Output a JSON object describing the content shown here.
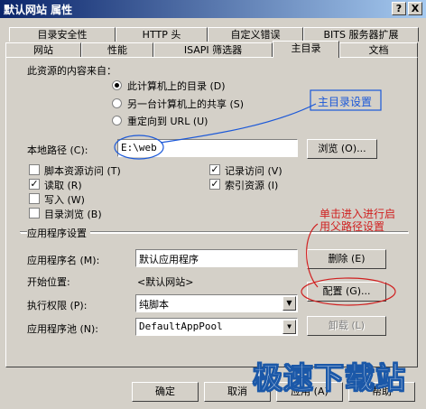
{
  "window": {
    "title": "默认网站 属性",
    "help_btn": "?",
    "close_btn": "X"
  },
  "tabs_row1": [
    {
      "label": "目录安全性"
    },
    {
      "label": "HTTP 头"
    },
    {
      "label": "自定义错误"
    },
    {
      "label": "BITS 服务器扩展"
    }
  ],
  "tabs_row2": [
    {
      "label": "网站"
    },
    {
      "label": "性能"
    },
    {
      "label": "ISAPI 筛选器"
    },
    {
      "label": "主目录",
      "active": true
    },
    {
      "label": "文档"
    }
  ],
  "source": {
    "heading": "此资源的内容来自：",
    "options": [
      {
        "label": "此计算机上的目录 (D)",
        "selected": true
      },
      {
        "label": "另一台计算机上的共享 (S)",
        "selected": false
      },
      {
        "label": "重定向到 URL (U)",
        "selected": false
      }
    ]
  },
  "local_path": {
    "label": "本地路径 (C):",
    "value": "E:\\web",
    "browse_btn": "浏览 (O)..."
  },
  "permissions": {
    "left": [
      {
        "label": "脚本资源访问 (T)",
        "checked": false
      },
      {
        "label": "读取 (R)",
        "checked": true
      },
      {
        "label": "写入 (W)",
        "checked": false
      },
      {
        "label": "目录浏览 (B)",
        "checked": false
      }
    ],
    "right": [
      {
        "label": "记录访问 (V)",
        "checked": true
      },
      {
        "label": "索引资源 (I)",
        "checked": true
      }
    ]
  },
  "app_settings": {
    "heading": "应用程序设置",
    "app_name_label": "应用程序名 (M):",
    "app_name_value": "默认应用程序",
    "remove_btn": "删除 (E)",
    "start_label": "开始位置:",
    "start_value": "<默认网站>",
    "config_btn": "配置 (G)...",
    "exec_label": "执行权限 (P):",
    "exec_value": "纯脚本",
    "pool_label": "应用程序池 (N):",
    "pool_value": "DefaultAppPool",
    "unload_btn": "卸载 (L)"
  },
  "annotations": {
    "home_dir": "主目录设置",
    "config_note_1": "单击进入进行启",
    "config_note_2": "用父路径设置"
  },
  "footer": {
    "ok": "确定",
    "cancel": "取消",
    "apply": "应用 (A)",
    "help": "帮助"
  },
  "watermark": "极速下载站",
  "colors": {
    "titlebar_start": "#0a246a",
    "titlebar_end": "#a6caf0",
    "annotation_blue": "#1b58d8",
    "annotation_red": "#d02020"
  }
}
